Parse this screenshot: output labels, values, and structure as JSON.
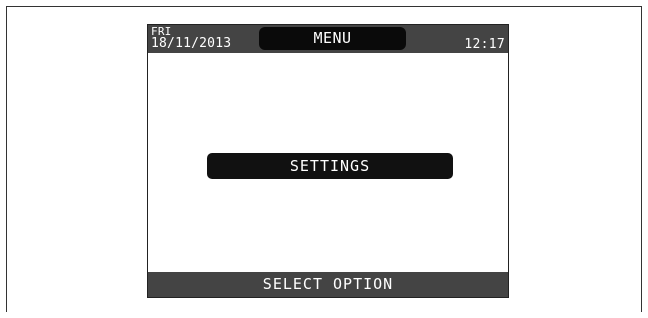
{
  "status_bar": {
    "day": "FRI",
    "date": "18/11/2013",
    "title": "MENU",
    "time": "12:17"
  },
  "menu": {
    "selected_option": "SETTINGS"
  },
  "footer": {
    "prompt": "SELECT OPTION"
  },
  "colors": {
    "bar_background": "#444444",
    "pill_background": "#111111",
    "screen_background": "#ffffff",
    "text_light": "#ffffff"
  }
}
